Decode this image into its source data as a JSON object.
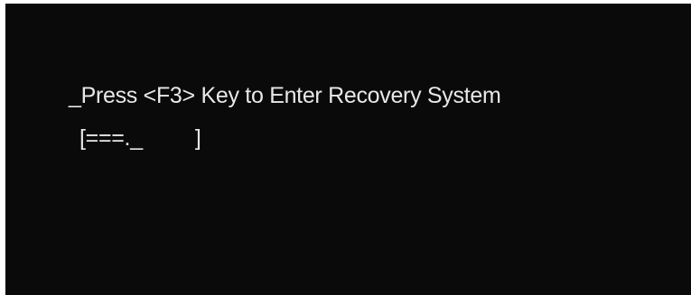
{
  "boot": {
    "prompt": "_Press <F3> Key to Enter Recovery System",
    "progress_open": "[",
    "progress_fill": "===._",
    "progress_close": "]",
    "progress_fraction": 0.4
  },
  "colors": {
    "background": "#0a0a0a",
    "text": "#e8e8e8"
  }
}
